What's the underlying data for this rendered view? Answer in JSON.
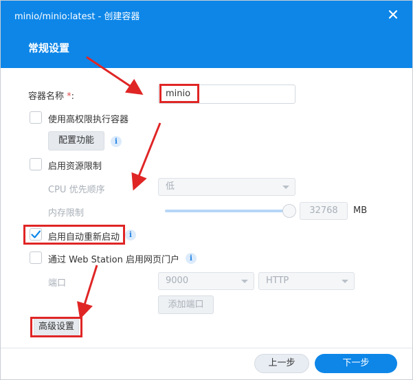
{
  "window": {
    "title": "minio/minio:latest - 创建容器",
    "section_title": "常规设置"
  },
  "form": {
    "container_name_label": "容器名称",
    "required_mark": "*",
    "colon": ":",
    "container_name_value": "minio",
    "privileged_label": "使用高权限执行容器",
    "privileged_checked": false,
    "config_button": "配置功能",
    "resource_limit_label": "启用资源限制",
    "resource_limit_checked": false,
    "cpu_priority_label": "CPU 优先顺序",
    "cpu_priority_value": "低",
    "memory_limit_label": "内存限制",
    "memory_limit_value": "32768",
    "memory_unit": "MB",
    "memory_slider_fraction": 1.0,
    "auto_restart_label": "启用自动重新启动",
    "auto_restart_checked": true,
    "web_station_label": "通过 Web Station 启用网页门户",
    "web_station_checked": false,
    "port_label": "端口",
    "port_value": "9000",
    "protocol_value": "HTTP",
    "add_port_button": "添加端口",
    "advanced_button": "高级设置"
  },
  "footer": {
    "prev_button": "上一步",
    "next_button": "下一步"
  },
  "icons": {
    "info": "i",
    "close": "close-icon",
    "check": "checkmark-icon"
  },
  "colors": {
    "accent": "#0d86e8",
    "annotation": "#e02525"
  }
}
